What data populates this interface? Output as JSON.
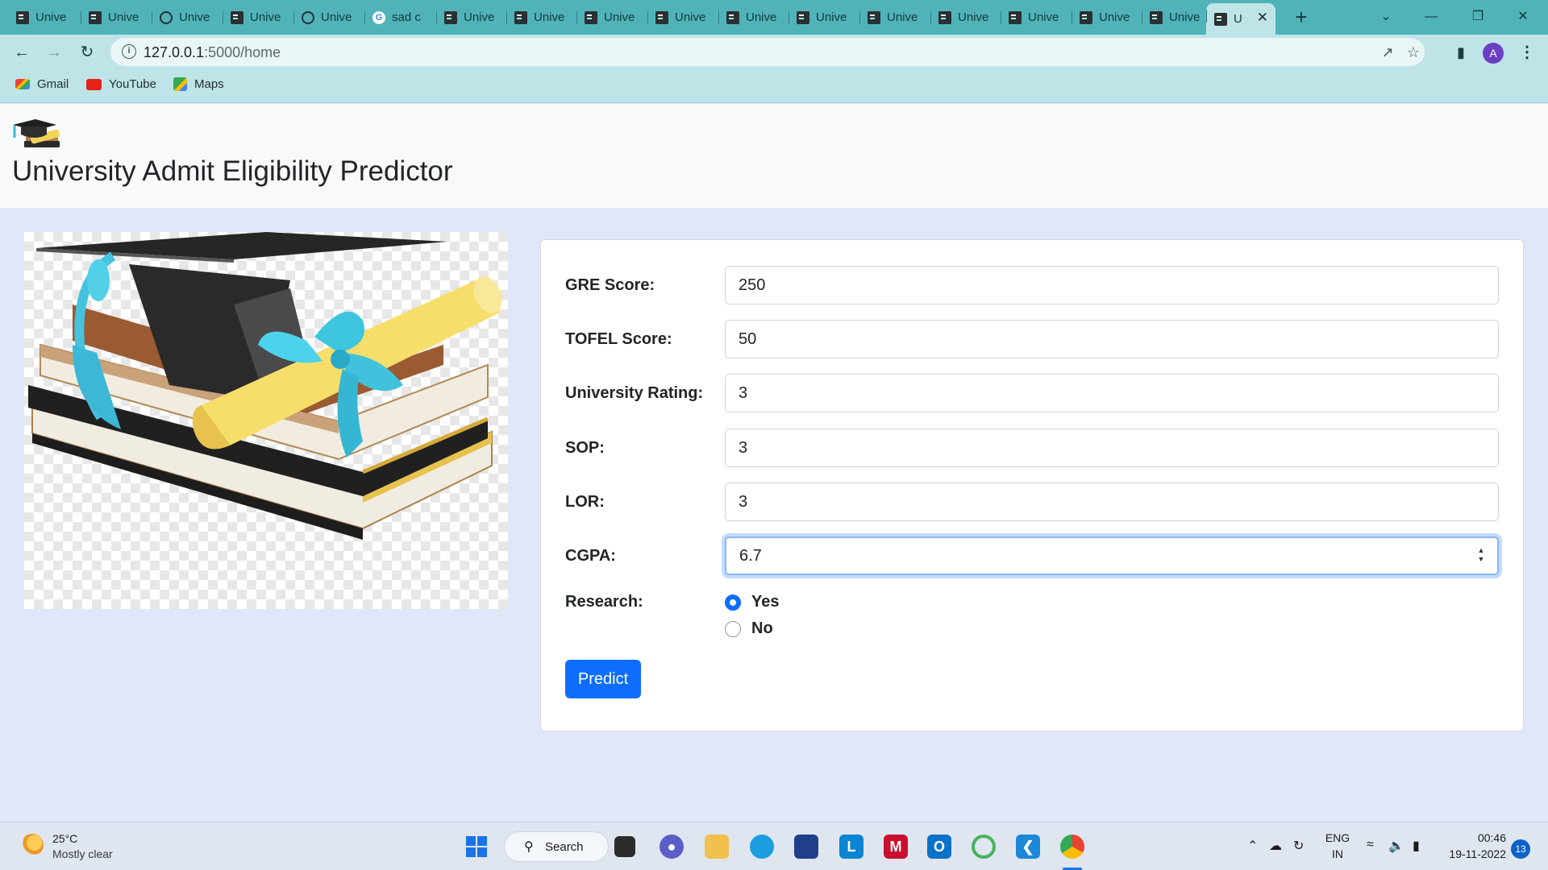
{
  "browser": {
    "tabs": [
      {
        "label": "Unive",
        "icon": "terminal"
      },
      {
        "label": "Unive",
        "icon": "terminal"
      },
      {
        "label": "Unive",
        "icon": "globe"
      },
      {
        "label": "Unive",
        "icon": "terminal"
      },
      {
        "label": "Unive",
        "icon": "globe"
      },
      {
        "label": "sad c",
        "icon": "google"
      },
      {
        "label": "Unive",
        "icon": "terminal"
      },
      {
        "label": "Unive",
        "icon": "terminal"
      },
      {
        "label": "Unive",
        "icon": "terminal"
      },
      {
        "label": "Unive",
        "icon": "terminal"
      },
      {
        "label": "Unive",
        "icon": "terminal"
      },
      {
        "label": "Unive",
        "icon": "terminal"
      },
      {
        "label": "Unive",
        "icon": "terminal"
      },
      {
        "label": "Unive",
        "icon": "terminal"
      },
      {
        "label": "Unive",
        "icon": "terminal"
      },
      {
        "label": "Unive",
        "icon": "terminal"
      },
      {
        "label": "Unive",
        "icon": "terminal"
      },
      {
        "label": "U",
        "icon": "terminal",
        "active": true
      }
    ],
    "url_host": "127.0.0.1",
    "url_path": ":5000/home",
    "profile_initial": "A",
    "bookmarks": [
      {
        "label": "Gmail",
        "icon": "gmail-icon"
      },
      {
        "label": "YouTube",
        "icon": "youtube-icon"
      },
      {
        "label": "Maps",
        "icon": "maps-icon"
      }
    ],
    "colors": {
      "frame": "#50b3b9",
      "toolbar": "#bfe4e7"
    }
  },
  "page": {
    "title": "University Admit Eligibility Predictor",
    "form": {
      "gre_label": "GRE Score:",
      "gre_value": "250",
      "toefl_label": "TOFEL Score:",
      "toefl_value": "50",
      "rating_label": "University Rating:",
      "rating_value": "3",
      "sop_label": "SOP:",
      "sop_value": "3",
      "lor_label": "LOR:",
      "lor_value": "3",
      "cgpa_label": "CGPA:",
      "cgpa_value": "6.7",
      "research_label": "Research:",
      "research_yes": "Yes",
      "research_no": "No",
      "research_selected": "Yes",
      "submit_label": "Predict"
    },
    "colors": {
      "primary": "#0d6efd",
      "background": "#dfe7f8"
    }
  },
  "taskbar": {
    "weather_temp": "25°C",
    "weather_desc": "Mostly clear",
    "search_label": "Search",
    "lang_line1": "ENG",
    "lang_line2": "IN",
    "time": "00:46",
    "date": "19-11-2022",
    "notification_count": "13"
  }
}
